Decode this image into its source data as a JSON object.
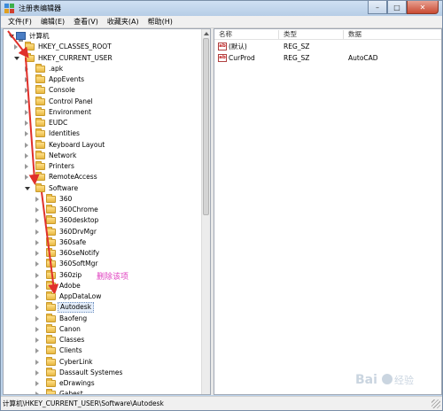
{
  "window": {
    "title": "注册表编辑器"
  },
  "menu": [
    {
      "label": "文件(F)"
    },
    {
      "label": "编辑(E)"
    },
    {
      "label": "查看(V)"
    },
    {
      "label": "收藏夹(A)"
    },
    {
      "label": "帮助(H)"
    }
  ],
  "tree": {
    "root": "计算机",
    "items": [
      {
        "label": "HKEY_CLASSES_ROOT",
        "state": "collapsed",
        "level": 1
      },
      {
        "label": "HKEY_CURRENT_USER",
        "state": "expanded",
        "level": 1
      },
      {
        "label": ".apk",
        "state": "collapsed",
        "level": 2
      },
      {
        "label": "AppEvents",
        "state": "collapsed",
        "level": 2
      },
      {
        "label": "Console",
        "state": "collapsed",
        "level": 2
      },
      {
        "label": "Control Panel",
        "state": "collapsed",
        "level": 2
      },
      {
        "label": "Environment",
        "state": "collapsed",
        "level": 2
      },
      {
        "label": "EUDC",
        "state": "collapsed",
        "level": 2
      },
      {
        "label": "Identities",
        "state": "collapsed",
        "level": 2
      },
      {
        "label": "Keyboard Layout",
        "state": "collapsed",
        "level": 2
      },
      {
        "label": "Network",
        "state": "collapsed",
        "level": 2
      },
      {
        "label": "Printers",
        "state": "collapsed",
        "level": 2
      },
      {
        "label": "RemoteAccess",
        "state": "collapsed",
        "level": 2
      },
      {
        "label": "Software",
        "state": "expanded",
        "level": 2
      },
      {
        "label": "360",
        "state": "collapsed",
        "level": 3
      },
      {
        "label": "360Chrome",
        "state": "collapsed",
        "level": 3
      },
      {
        "label": "360desktop",
        "state": "collapsed",
        "level": 3
      },
      {
        "label": "360DrvMgr",
        "state": "collapsed",
        "level": 3
      },
      {
        "label": "360safe",
        "state": "collapsed",
        "level": 3
      },
      {
        "label": "360seNotify",
        "state": "collapsed",
        "level": 3
      },
      {
        "label": "360SoftMgr",
        "state": "collapsed",
        "level": 3
      },
      {
        "label": "360zip",
        "state": "collapsed",
        "level": 3
      },
      {
        "label": "Adobe",
        "state": "collapsed",
        "level": 3
      },
      {
        "label": "AppDataLow",
        "state": "collapsed",
        "level": 3
      },
      {
        "label": "Autodesk",
        "state": "collapsed",
        "level": 3,
        "selected": true
      },
      {
        "label": "Baofeng",
        "state": "collapsed",
        "level": 3
      },
      {
        "label": "Canon",
        "state": "collapsed",
        "level": 3
      },
      {
        "label": "Classes",
        "state": "collapsed",
        "level": 3
      },
      {
        "label": "Clients",
        "state": "collapsed",
        "level": 3
      },
      {
        "label": "CyberLink",
        "state": "collapsed",
        "level": 3
      },
      {
        "label": "Dassault Systemes",
        "state": "collapsed",
        "level": 3
      },
      {
        "label": "eDrawings",
        "state": "collapsed",
        "level": 3
      },
      {
        "label": "Gabest",
        "state": "collapsed",
        "level": 3
      }
    ]
  },
  "annotation": "删除该项",
  "list": {
    "headers": [
      "名称",
      "类型",
      "数据"
    ],
    "rows": [
      {
        "name": "(默认)",
        "type": "REG_SZ",
        "data": ""
      },
      {
        "name": "CurProd",
        "type": "REG_SZ",
        "data": "AutoCAD"
      }
    ]
  },
  "status": "计算机\\HKEY_CURRENT_USER\\Software\\Autodesk",
  "colors": {
    "accent_arrow": "#e0302a",
    "annotation": "#e040c0"
  },
  "icons": {
    "value": "ab-icon",
    "folder": "folder-icon",
    "computer": "computer-icon"
  }
}
